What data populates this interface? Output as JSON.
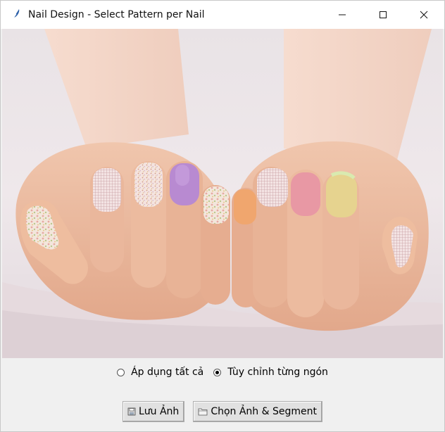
{
  "window": {
    "title": "Nail Design - Select Pattern per Nail"
  },
  "photo": {
    "subject": "hands-with-painted-nails"
  },
  "mode": {
    "options": [
      {
        "label": "Áp dụng tất cả",
        "selected": false
      },
      {
        "label": "Tùy chỉnh từng ngón",
        "selected": true
      }
    ]
  },
  "buttons": {
    "save_label": "Lưu Ảnh",
    "select_label": "Chọn Ảnh & Segment"
  },
  "colors": {
    "titlebar_bg": "#ffffff",
    "window_bg": "#f0f0f0",
    "button_bg": "#e1e1e1"
  },
  "icons": {
    "app": "feather-icon",
    "minimize": "minimize-icon",
    "maximize": "maximize-icon",
    "close": "close-icon",
    "save": "floppy-disk-icon",
    "folder": "folder-icon"
  }
}
